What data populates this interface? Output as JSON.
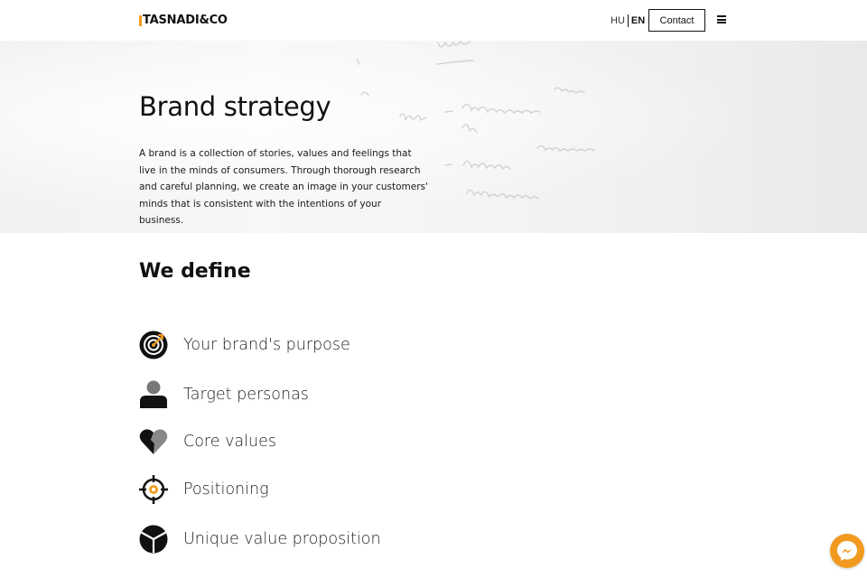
{
  "header": {
    "logo": "TASNADI&CO",
    "lang_hu": "HU",
    "lang_en": "EN",
    "contact_label": "Contact",
    "menu_icon": "hamburger-menu-icon"
  },
  "hero": {
    "title": "Brand strategy",
    "description": "A brand is a collection of stories, values and feelings that live in the minds of consumers. Through thorough research and careful planning, we create an image in your customers' minds that is consistent with the intentions of your business."
  },
  "define": {
    "title": "We define",
    "items": [
      {
        "label": "Your brand's purpose",
        "icon": "target-icon"
      },
      {
        "label": "Target personas",
        "icon": "person-icon"
      },
      {
        "label": "Core values",
        "icon": "heart-icon"
      },
      {
        "label": "Positioning",
        "icon": "crosshair-icon"
      },
      {
        "label": "Unique value proposition",
        "icon": "cube-icon"
      }
    ]
  },
  "colors": {
    "accent": "#f29a1f",
    "text": "#111111"
  },
  "messenger": {
    "icon": "messenger-icon"
  }
}
